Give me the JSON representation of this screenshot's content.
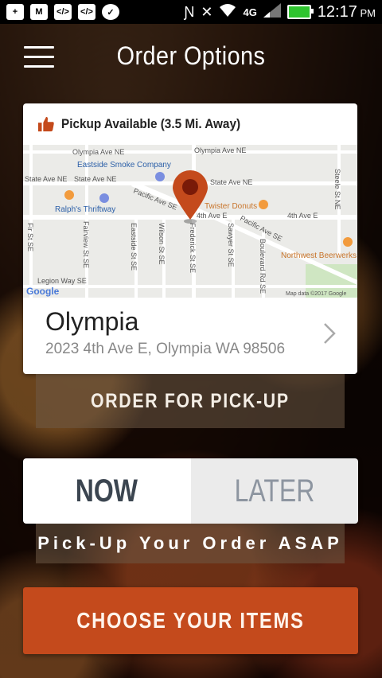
{
  "status_bar": {
    "time": "12:17",
    "ampm": "PM",
    "network": "4G",
    "left_icons": [
      "add-icon",
      "gmail-icon",
      "code-icon",
      "code-icon",
      "check-icon",
      "nfc-icon",
      "mute-icon"
    ],
    "right_icons": [
      "wifi-icon",
      "lte-icon",
      "signal-icon",
      "battery-charging-icon"
    ]
  },
  "header": {
    "title": "Order Options",
    "menu_icon": "hamburger-icon"
  },
  "pickup_card": {
    "availability": "Pickup Available (3.5 Mi. Away)",
    "accent_color": "#c44a1c",
    "map": {
      "labels": [
        "Olympia Ave NE",
        "Olympia Ave NE",
        "Eastside Smoke Company",
        "State Ave NE",
        "State Ave NE",
        "State Ave NE",
        "Pacific Ave SE",
        "Twister Donuts",
        "Ralph's Thriftway",
        "4th Ave E",
        "4th Ave E",
        "Pacific Ave SE",
        "Steele St NE",
        "Fir St SE",
        "Fairview St SE",
        "Eastside St SE",
        "Wilson St SE",
        "Frederick St SE",
        "Sawyer St SE",
        "Boulevard Rd SE",
        "Northwest Beerwerks",
        "Legion Way SE",
        "Google",
        "Map data ©2017 Google"
      ]
    },
    "location_name": "Olympia",
    "location_address": "2023 4th Ave E, Olympia WA 98506"
  },
  "pickup_button": {
    "label": "ORDER FOR PICK-UP"
  },
  "timing_toggle": {
    "options": [
      "NOW",
      "LATER"
    ],
    "selected": "NOW"
  },
  "timing_caption": "Pick-Up Your Order ASAP",
  "choose_button": {
    "label": "CHOOSE YOUR ITEMS"
  }
}
